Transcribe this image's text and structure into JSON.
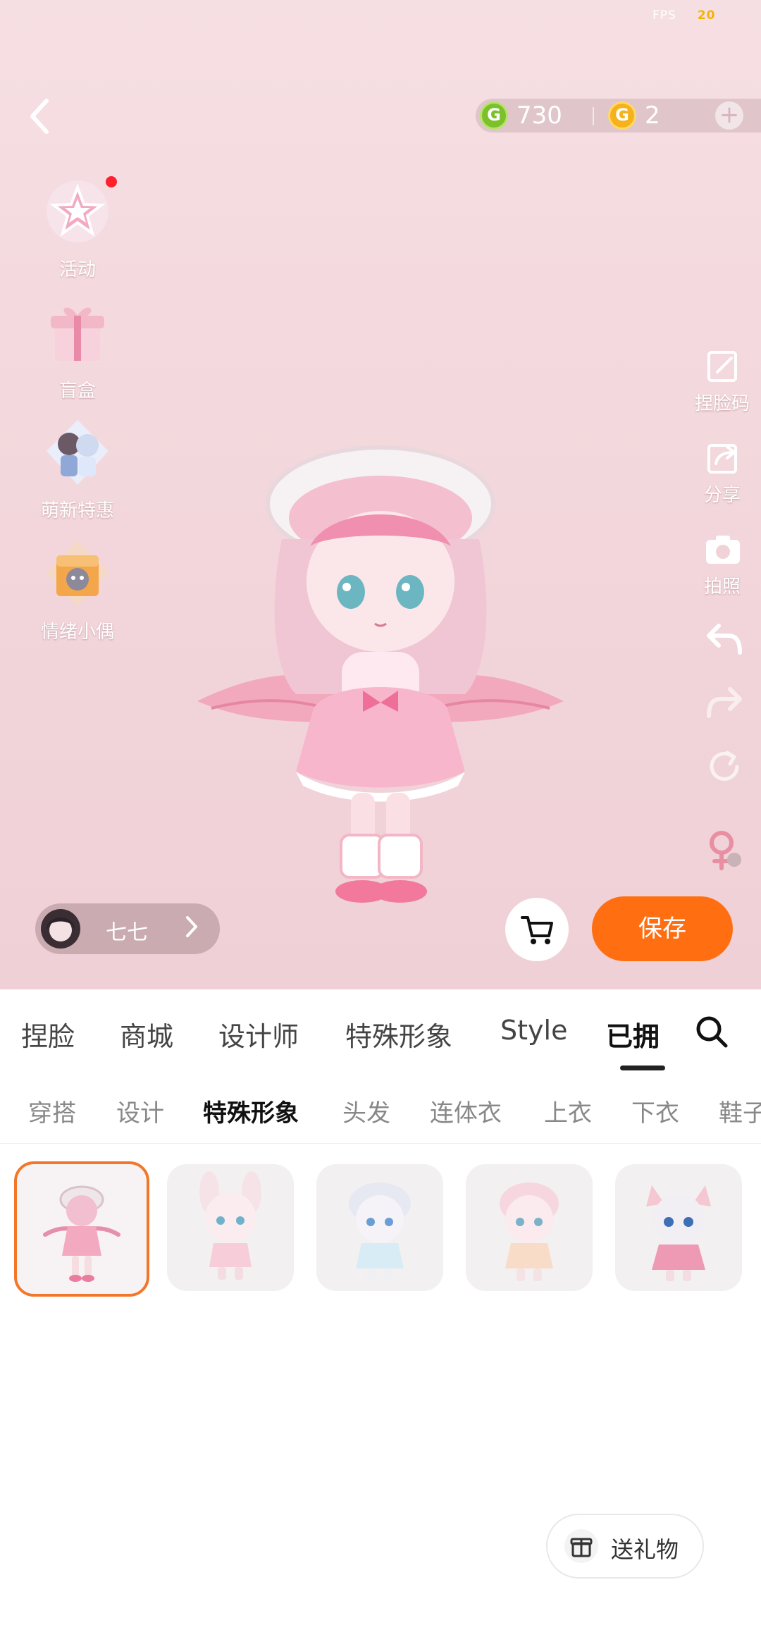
{
  "status": {
    "fps_label": "FPS",
    "fps_value": "20"
  },
  "currency": {
    "green_value": "730",
    "gold_value": "2",
    "coin_letter": "G"
  },
  "left_menu": [
    {
      "label": "活动",
      "icon": "star-icon",
      "has_dot": true
    },
    {
      "label": "盲盒",
      "icon": "gift-box-icon"
    },
    {
      "label": "萌新特惠",
      "icon": "character-pack-icon"
    },
    {
      "label": "情绪小偶",
      "icon": "doll-box-icon"
    }
  ],
  "right_menu": [
    {
      "label": "捏脸码",
      "icon": "face-code-icon"
    },
    {
      "label": "分享",
      "icon": "share-icon"
    },
    {
      "label": "拍照",
      "icon": "camera-icon"
    },
    {
      "label": "",
      "icon": "undo-icon"
    },
    {
      "label": "",
      "icon": "redo-icon"
    },
    {
      "label": "",
      "icon": "reset-icon"
    },
    {
      "label": "",
      "icon": "gender-switch-icon"
    }
  ],
  "user": {
    "name": "七七"
  },
  "actions": {
    "save_label": "保存"
  },
  "main_tabs": [
    {
      "label": "捏脸"
    },
    {
      "label": "商城"
    },
    {
      "label": "设计师"
    },
    {
      "label": "特殊形象"
    },
    {
      "label": "Style"
    },
    {
      "label": "已拥",
      "active": true
    }
  ],
  "sub_tabs": [
    {
      "label": "穿搭"
    },
    {
      "label": "设计"
    },
    {
      "label": "特殊形象",
      "active": true
    },
    {
      "label": "头发"
    },
    {
      "label": "连体衣"
    },
    {
      "label": "上衣"
    },
    {
      "label": "下衣"
    },
    {
      "label": "鞋子"
    }
  ],
  "items": [
    {
      "name": "pink-angel-outfit",
      "selected": true
    },
    {
      "name": "bunny-ear-outfit"
    },
    {
      "name": "white-twin-tail-outfit"
    },
    {
      "name": "peach-bow-outfit"
    },
    {
      "name": "cat-ear-outfit"
    }
  ],
  "gift": {
    "label": "送礼物"
  },
  "colors": {
    "accent": "#ff6f12",
    "selected_border": "#f2772a",
    "stage_bg": "#f3d9de"
  }
}
